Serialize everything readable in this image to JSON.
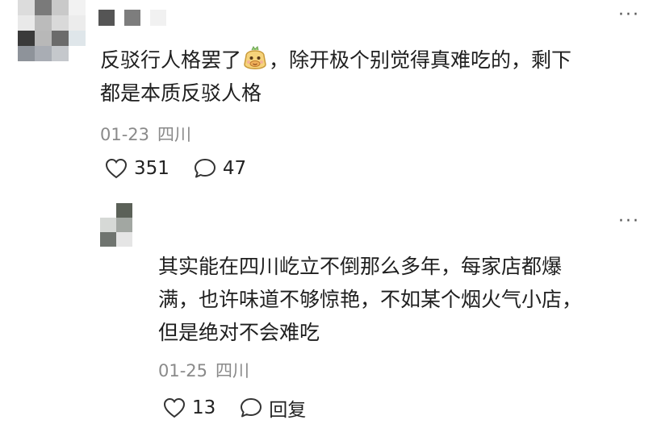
{
  "comment": {
    "avatar_colors": [
      "#dcdcdc",
      "#7a7a7a",
      "#c9c9c9",
      "#f2f2f2",
      "#e9e9e9",
      "#bbbbbb",
      "#d9d9d9",
      "#ececec",
      "#3a3a3a",
      "#b8b8b8",
      "#6b6b6b",
      "#dfe6ea",
      "#8e939a",
      "#a9adb4",
      "#c5c8cc",
      "#ffffff"
    ],
    "text_before_emoji": "反驳行人格罢了",
    "emoji": "smiling-face-emoji",
    "text_after_emoji": "，除开极个别觉得真难吃的，剩下\n都是本质反驳人格",
    "date": "01-23",
    "location": "四川",
    "like_count": "351",
    "reply_count": "47"
  },
  "reply": {
    "avatar_colors": [
      "#ffffff",
      "#5b6158",
      "#d6d9d6",
      "#a2a7a2",
      "#6f746f",
      "#e5e5e5"
    ],
    "text": "其实能在四川屹立不倒那么多年，每家店都爆\n满，也许味道不够惊艳，不如某个烟火气小店，\n但是绝对不会难吃",
    "date": "01-25",
    "location": "四川",
    "like_count": "13",
    "reply_label": "回复"
  },
  "colors": {
    "username_block_1": "#555555",
    "username_block_2": "#7d7d7d",
    "meta": "#8a8a8a"
  }
}
